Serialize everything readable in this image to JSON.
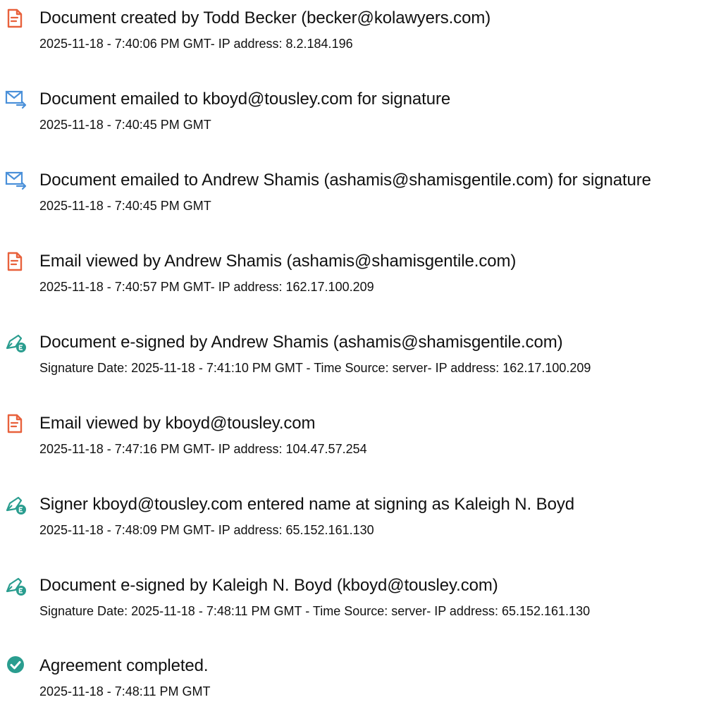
{
  "colors": {
    "doc_icon": "#e8613c",
    "email_icon": "#4a90d9",
    "sign_icon": "#2a9d8f",
    "check_icon": "#2a9d8f",
    "text": "#111111"
  },
  "events": [
    {
      "icon": "document-icon",
      "title": "Document created by Todd Becker (becker@kolawyers.com)",
      "detail": "2025-11-18 - 7:40:06 PM GMT- IP address: 8.2.184.196"
    },
    {
      "icon": "email-send-icon",
      "title": "Document emailed to kboyd@tousley.com for signature",
      "detail": "2025-11-18 - 7:40:45 PM GMT"
    },
    {
      "icon": "email-send-icon",
      "title": "Document emailed to Andrew Shamis (ashamis@shamisgentile.com) for signature",
      "detail": "2025-11-18 - 7:40:45 PM GMT"
    },
    {
      "icon": "document-icon",
      "title": "Email viewed by Andrew Shamis (ashamis@shamisgentile.com)",
      "detail": "2025-11-18 - 7:40:57 PM GMT- IP address: 162.17.100.209"
    },
    {
      "icon": "pen-sign-icon",
      "title": "Document e-signed by Andrew Shamis (ashamis@shamisgentile.com)",
      "detail": "Signature Date: 2025-11-18 - 7:41:10 PM GMT - Time Source: server- IP address: 162.17.100.209"
    },
    {
      "icon": "document-icon",
      "title": "Email viewed by kboyd@tousley.com",
      "detail": "2025-11-18 - 7:47:16 PM GMT- IP address: 104.47.57.254"
    },
    {
      "icon": "pen-sign-icon",
      "title": "Signer kboyd@tousley.com entered name at signing as Kaleigh N. Boyd",
      "detail": "2025-11-18 - 7:48:09 PM GMT- IP address: 65.152.161.130"
    },
    {
      "icon": "pen-sign-icon",
      "title": "Document e-signed by Kaleigh N. Boyd (kboyd@tousley.com)",
      "detail": "Signature Date: 2025-11-18 - 7:48:11 PM GMT - Time Source: server- IP address: 65.152.161.130"
    },
    {
      "icon": "check-circle-icon",
      "title": "Agreement completed.",
      "detail": "2025-11-18 - 7:48:11 PM GMT"
    }
  ]
}
